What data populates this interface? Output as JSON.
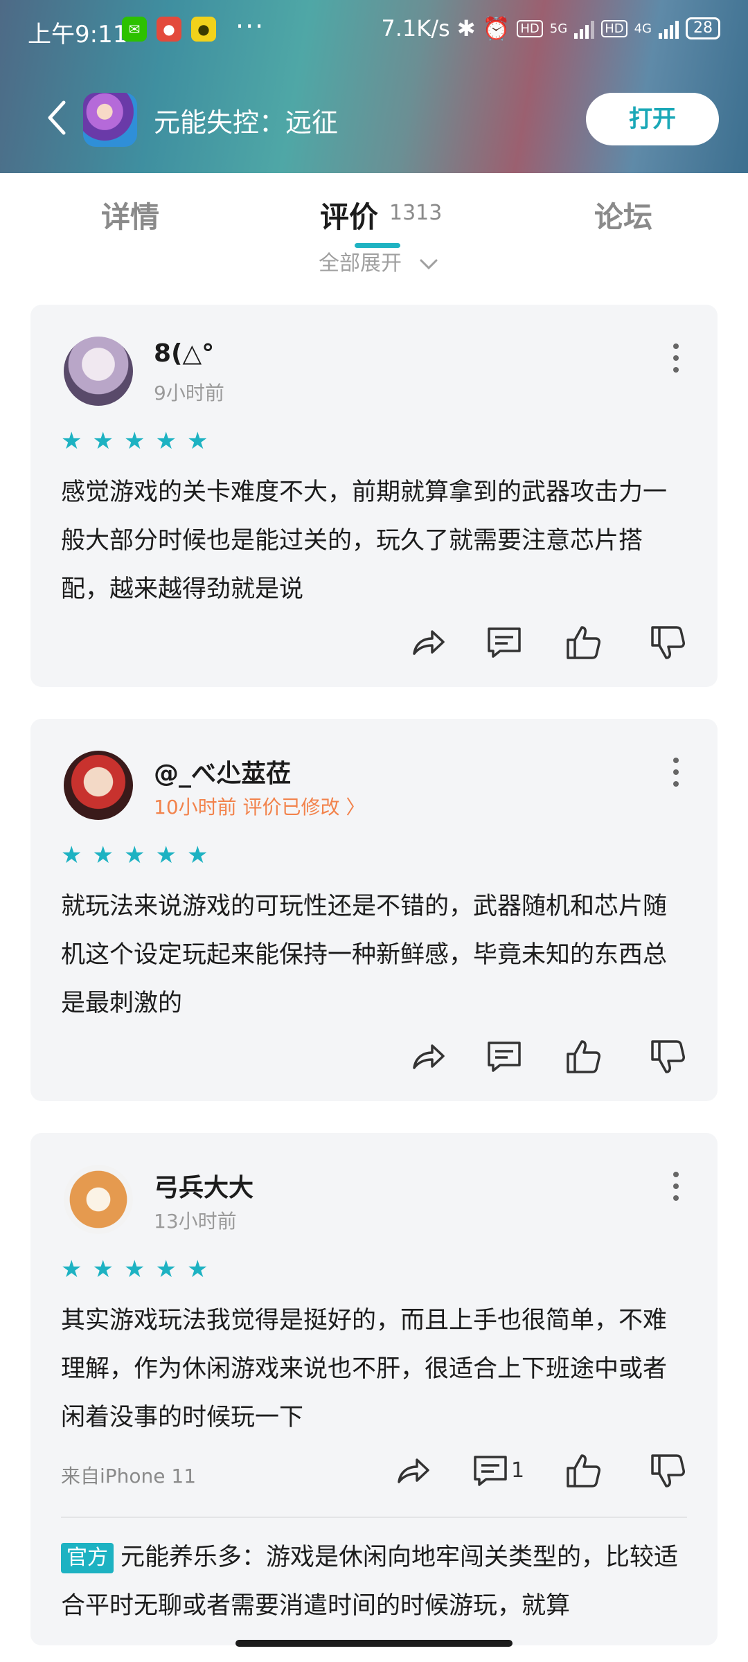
{
  "status_bar": {
    "time": "上午9:11",
    "more": "···",
    "net_speed": "7.1K/s",
    "hd1": "HD",
    "net1": "5G",
    "hd2": "HD",
    "net2": "4G",
    "battery": "28"
  },
  "app_bar": {
    "app_name": "元能失控：远征",
    "open_label": "打开"
  },
  "tabs": {
    "details": "详情",
    "reviews": "评价",
    "reviews_count": "1313",
    "forum": "论坛",
    "filter_label": "全部展开"
  },
  "reviews": [
    {
      "username": "8(△°",
      "time": "9小时前",
      "rating": 5,
      "text": "感觉游戏的关卡难度不大，前期就算拿到的武器攻击力一般大部分时候也是能过关的，玩久了就需要注意芯片搭配，越来越得劲就是说"
    },
    {
      "username": "@_べ尐莁莅",
      "time": "10小时前 评价已修改 〉",
      "rating": 5,
      "text": "就玩法来说游戏的可玩性还是不错的，武器随机和芯片随机这个设定玩起来能保持一种新鲜感，毕竟未知的东西总是最刺激的"
    },
    {
      "username": "弓兵大大",
      "time": "13小时前",
      "rating": 5,
      "text": "其实游戏玩法我觉得是挺好的，而且上手也很简单，不难理解，作为休闲游戏来说也不肝，很适合上下班途中或者闲着没事的时候玩一下",
      "device": "来自iPhone 11",
      "comment_count": "1",
      "official_badge": "官方",
      "official_reply": "元能养乐多：游戏是休闲向地牢闯关类型的，比较适合平时无聊或者需要消遣时间的时候游玩，就算"
    }
  ],
  "colors": {
    "accent": "#1db2c2",
    "edited": "#f2834c",
    "card_bg": "#f4f5f7"
  }
}
